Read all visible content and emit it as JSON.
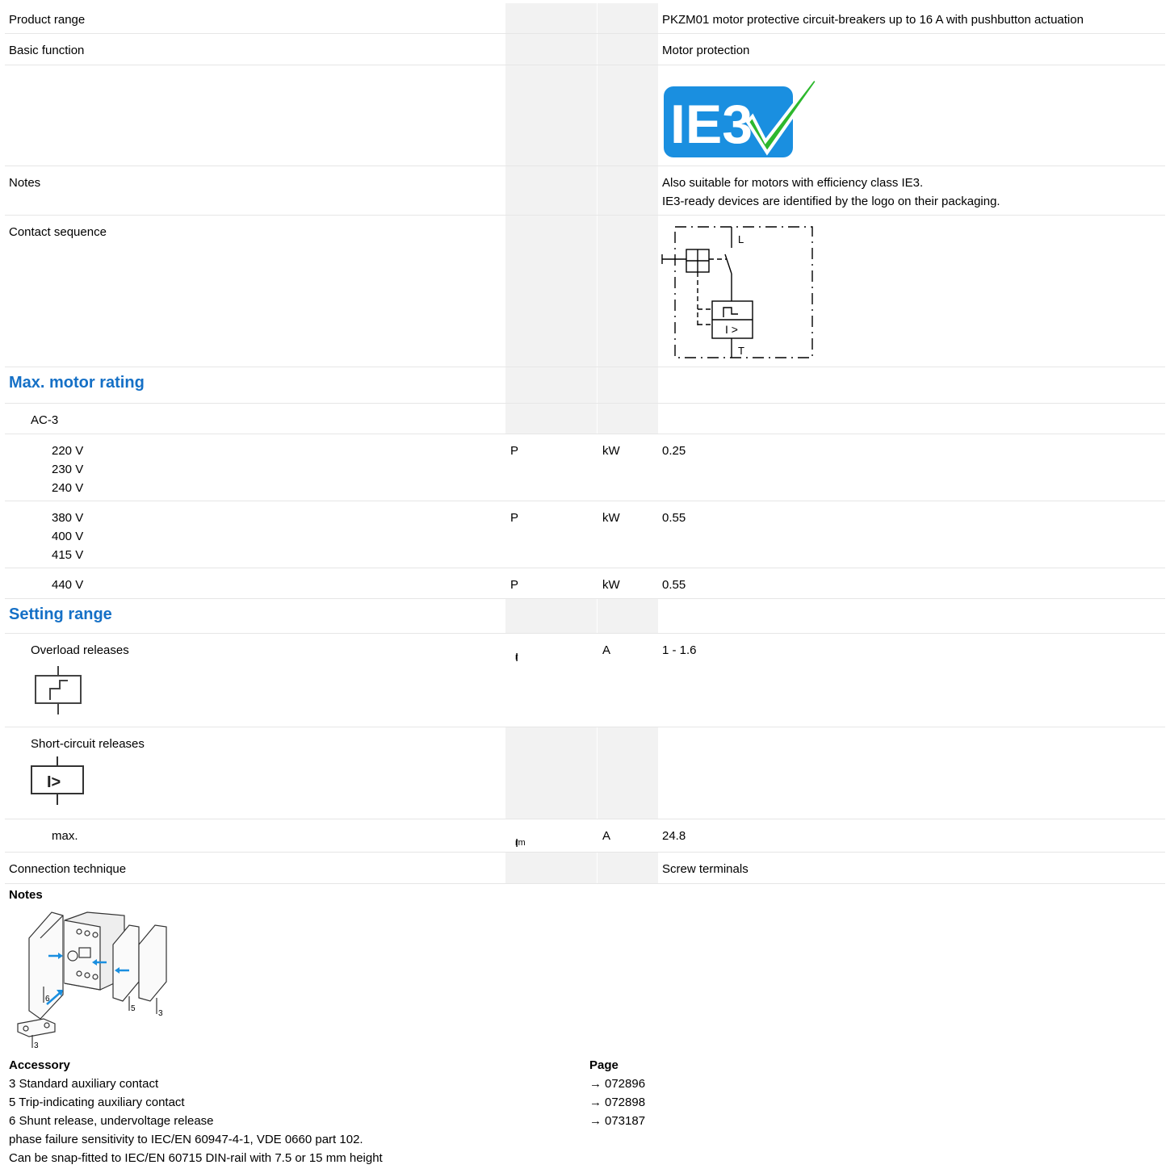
{
  "table": {
    "product_range_label": "Product range",
    "product_range_value": "PKZM01 motor protective circuit-breakers up to 16 A with pushbutton actuation",
    "basic_function_label": "Basic function",
    "basic_function_value": "Motor protection",
    "logo_text": "IE3",
    "notes_label": "Notes",
    "notes_line1": "Also suitable for motors with efficiency class IE3.",
    "notes_line2": "IE3-ready devices are identified by the logo on their packaging.",
    "contact_sequence_label": "Contact sequence",
    "diagram_L": "L",
    "diagram_T": "T",
    "diagram_I": "I >",
    "max_motor_rating": "Max. motor rating",
    "ac3": "AC-3",
    "row1_v1": "220 V",
    "row1_v2": "230 V",
    "row1_v3": "240 V",
    "row2_v1": "380 V",
    "row2_v2": "400 V",
    "row2_v3": "415 V",
    "row3_v1": "440 V",
    "sym_p": "P",
    "unit_kw": "kW",
    "row1_value": "0.25",
    "row2_value": "0.55",
    "row3_value": "0.55",
    "setting_range": "Setting range",
    "overload_label": "Overload releases",
    "overload_sym": "I",
    "overload_sub": "r",
    "unit_a": "A",
    "overload_value": "1 - 1.6",
    "short_circuit_label": "Short-circuit releases",
    "short_circuit_icon_text": "I>",
    "max_label": "max.",
    "max_sym": "I",
    "max_sub": "rm",
    "max_value": "24.8",
    "connection_label": "Connection technique",
    "connection_value": "Screw terminals"
  },
  "footer": {
    "notes_heading": "Notes",
    "img_label_6": "6",
    "img_label_5": "5",
    "img_label_3a": "3",
    "img_label_3b": "3",
    "accessory_heading": "Accessory",
    "page_heading": "Page",
    "acc1": "3 Standard auxiliary contact",
    "acc2": "5 Trip-indicating auxiliary contact",
    "acc3": "6 Shunt release, undervoltage release",
    "acc4": "phase failure sensitivity to IEC/EN 60947-4-1, VDE 0660 part 102.",
    "acc5": "Can be snap-fitted to IEC/EN 60715 DIN-rail with 7.5 or 15 mm height",
    "arrow": "→",
    "page1": "072896",
    "page2": "072898",
    "page3": "073187"
  }
}
